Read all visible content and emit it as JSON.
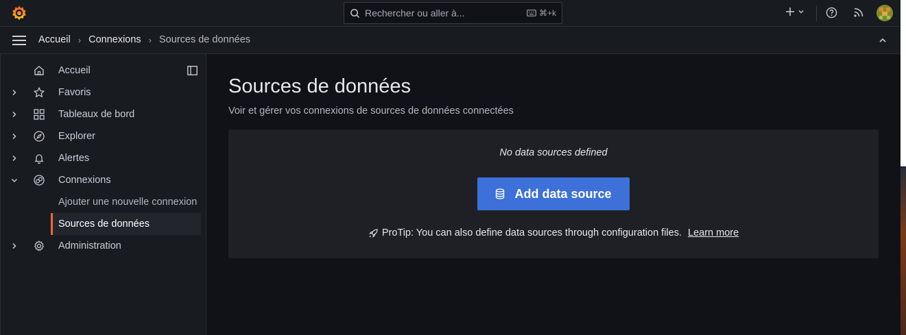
{
  "topbar": {
    "search_placeholder": "Rechercher ou aller à...",
    "search_shortcut": "⌘+k"
  },
  "breadcrumb": [
    "Accueil",
    "Connexions",
    "Sources de données"
  ],
  "sidebar": {
    "items": [
      {
        "label": "Accueil",
        "icon": "home-icon"
      },
      {
        "label": "Favoris",
        "icon": "star-icon"
      },
      {
        "label": "Tableaux de bord",
        "icon": "apps-icon"
      },
      {
        "label": "Explorer",
        "icon": "compass-icon"
      },
      {
        "label": "Alertes",
        "icon": "bell-icon"
      },
      {
        "label": "Connexions",
        "icon": "connections-icon"
      },
      {
        "label": "Administration",
        "icon": "cog-icon"
      }
    ],
    "subitems": [
      {
        "label": "Ajouter une nouvelle connexion"
      },
      {
        "label": "Sources de données",
        "active": true
      }
    ]
  },
  "main": {
    "title": "Sources de données",
    "subtitle": "Voir et gérer vos connexions de sources de données connectées",
    "empty_title": "No data sources defined",
    "add_button": "Add data source",
    "protip": "ProTip: You can also define data sources through configuration files.",
    "learn_more": "Learn more"
  },
  "colors": {
    "accent": "#3d71d9",
    "active_indicator": "#f0673c",
    "background": "#111217",
    "panel": "#181b1f"
  }
}
